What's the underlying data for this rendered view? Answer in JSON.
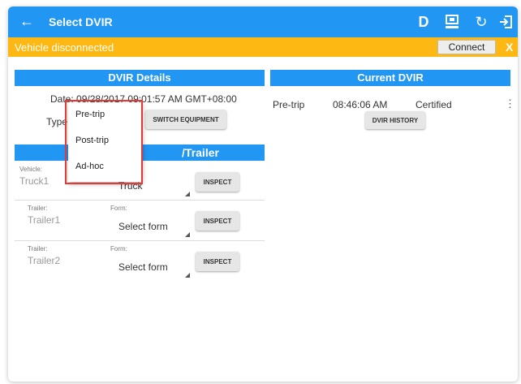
{
  "header": {
    "title": "Select DVIR",
    "action_d": "D"
  },
  "banner": {
    "message": "Vehicle disconnected",
    "connect_label": "Connect",
    "close_label": "X"
  },
  "dvir_details": {
    "title": "DVIR Details",
    "date_text": "Date: 09/28/2017 09:01:57 AM GMT+08:00",
    "type_label": "Type:",
    "switch_label": "SWITCH EQUIPMENT"
  },
  "vehicle_trailer": {
    "title": "/Trailer",
    "rows": [
      {
        "kind_label": "Vehicle:",
        "name": "Truck1",
        "form_label": "",
        "form_value": "Truck",
        "inspect_label": "INSPECT"
      },
      {
        "kind_label": "Trailer:",
        "name": "Trailer1",
        "form_label": "Form:",
        "form_value": "Select form",
        "inspect_label": "INSPECT"
      },
      {
        "kind_label": "Trailer:",
        "name": "Trailer2",
        "form_label": "Form:",
        "form_value": "Select form",
        "inspect_label": "INSPECT"
      }
    ]
  },
  "current_dvir": {
    "title": "Current DVIR",
    "type": "Pre-trip",
    "time": "08:46:06 AM",
    "status": "Certified",
    "history_label": "DVIR HISTORY"
  },
  "type_dropdown": {
    "options": [
      "Pre-trip",
      "Post-trip",
      "Ad-hoc"
    ]
  },
  "colors": {
    "primary": "#2196f3",
    "warning": "#fdb813",
    "highlight": "#e53935"
  }
}
